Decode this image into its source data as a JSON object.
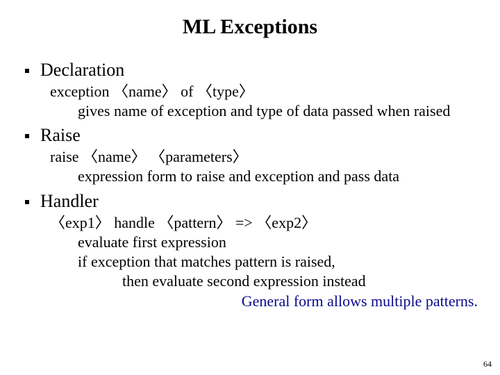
{
  "title": "ML Exceptions",
  "sections": {
    "declaration": {
      "label": "Declaration",
      "syntax": "exception 〈name〉 of 〈type〉",
      "desc": "gives name of exception and type of data passed when raised"
    },
    "raise": {
      "label": "Raise",
      "syntax": "raise 〈name〉 〈parameters〉",
      "desc": "expression form to raise and exception and pass data"
    },
    "handler": {
      "label": "Handler",
      "syntax": "〈exp1〉 handle 〈pattern〉 => 〈exp2〉",
      "desc1": "evaluate first expression",
      "desc2": "if exception that matches pattern is raised,",
      "desc3": "then evaluate second expression instead"
    }
  },
  "general_note": "General form allows multiple patterns.",
  "page_number": "64"
}
